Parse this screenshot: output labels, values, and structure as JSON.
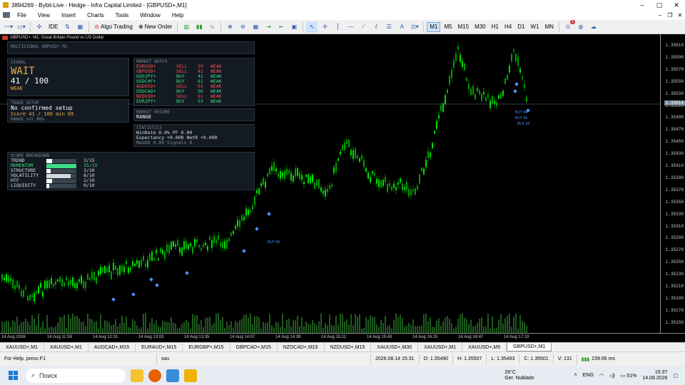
{
  "window": {
    "title": "3894269 - Bybit-Live - Hedge - Infra Capital Limited - [GBPUSD+,M1]",
    "controls": [
      "–",
      "▢",
      "✕"
    ]
  },
  "menu": {
    "items": [
      "File",
      "View",
      "Insert",
      "Charts",
      "Tools",
      "Window",
      "Help"
    ],
    "mdi_controls": [
      "–",
      "❐",
      "✕"
    ]
  },
  "toolbar": {
    "ide_label": "IDE",
    "algo_label": "Algo Trading",
    "new_order_label": "New Order",
    "timeframes": [
      "M1",
      "M5",
      "M15",
      "M30",
      "H1",
      "H4",
      "D1",
      "W1",
      "MN"
    ],
    "active_timeframe": "M1",
    "notification_count": "1"
  },
  "chart": {
    "header": "GBPUSD+, M1:  Great Britain Pound vs US Dollar",
    "subheader": "MULTISIGNAL   GBPUSD+ M1",
    "current_price": "1.35514",
    "price_labels": [
      "1.35610",
      "1.35590",
      "1.35570",
      "1.35550",
      "1.35530",
      "1.35510",
      "1.35490",
      "1.35470",
      "1.35450",
      "1.35430",
      "1.35410",
      "1.35390",
      "1.35370",
      "1.35350",
      "1.35330",
      "1.35310",
      "1.35290",
      "1.35270",
      "1.35250",
      "1.35230",
      "1.35210",
      "1.35190",
      "1.35170",
      "1.35150"
    ],
    "time_labels": [
      "14 Aug 2026",
      "14 Aug 11:59",
      "14 Aug 12:31",
      "14 Aug 13:03",
      "14 Aug 13:35",
      "14 Aug 14:07",
      "14 Aug 14:39",
      "14 Aug 15:11",
      "14 Aug 15:43",
      "14 Aug 16:15",
      "14 Aug 16:47",
      "14 Aug 17:19"
    ],
    "buy_labels": [
      "BUY 84",
      "BUY 65",
      "BUY 84",
      "BUY 65"
    ],
    "colors": {
      "bull": "#00e000",
      "bear": "#00a000",
      "bg": "#000000",
      "signal": "#4a90ff"
    }
  },
  "signal_panel": {
    "heading": "SIGNAL",
    "state": "WAIT",
    "score": "41 / 100",
    "strength": "WEAK"
  },
  "trade_setup": {
    "heading": "TRADE SETUP",
    "line1": "No confirmed setup",
    "line2": "Score 41 / 100   min 65",
    "line3": "RANGE   vol 86%"
  },
  "score_breakdown": {
    "heading": "SCORE BREAKDOWN",
    "rows": [
      {
        "name": "TREND",
        "value": "3/15",
        "fill": 0.2,
        "color": "#ffffff"
      },
      {
        "name": "MOMENTUM",
        "value": "15/15",
        "fill": 1.0,
        "color": "#3ddc84"
      },
      {
        "name": "STRUCTURE",
        "value": "3/20",
        "fill": 0.15,
        "color": "#ffffff"
      },
      {
        "name": "VOLATILITY",
        "value": "8/10",
        "fill": 0.8,
        "color": "#cfd8dc"
      },
      {
        "name": "HTF",
        "value": "2/10",
        "fill": 0.2,
        "color": "#ffffff"
      },
      {
        "name": "LIQUIDITY",
        "value": "0/10",
        "fill": 0.0,
        "color": "#ffffff"
      }
    ]
  },
  "market_watch": {
    "heading": "MARKET WATCH",
    "rows": [
      {
        "sym": "EURUSD+",
        "dir": "SELL",
        "score": "39",
        "str": "WEAK",
        "color": "#ff5252"
      },
      {
        "sym": "GBPUSD+",
        "dir": "SELL",
        "score": "41",
        "str": "WEAK",
        "color": "#ff5252"
      },
      {
        "sym": "USDJPY+",
        "dir": "BUY",
        "score": "41",
        "str": "WEAK",
        "color": "#3ddc84"
      },
      {
        "sym": "USDCHF+",
        "dir": "BUY",
        "score": "61",
        "str": "WEAK",
        "color": "#3ddc84"
      },
      {
        "sym": "AUDUSD+",
        "dir": "SELL",
        "score": "51",
        "str": "WEAK",
        "color": "#ff5252"
      },
      {
        "sym": "USDCAD+",
        "dir": "BUY",
        "score": "56",
        "str": "WEAK",
        "color": "#3ddc84"
      },
      {
        "sym": "NZDUSD+",
        "dir": "SELL",
        "score": "61",
        "str": "WEAK",
        "color": "#ff5252"
      },
      {
        "sym": "EURJPY+",
        "dir": "BUY",
        "score": "53",
        "str": "WEAK",
        "color": "#3ddc84"
      }
    ]
  },
  "market_regime": {
    "heading": "MARKET REGIME",
    "value": "RANGE"
  },
  "statistics": {
    "heading": "STATISTICS",
    "line1": "WinRate 0.0%   PF 0.00",
    "line2": "Expectancy +0.00R   NetR +0.00R",
    "line3": "MaxDD 0.00   Signals 0"
  },
  "tabs": [
    "XAUUSD+,M1",
    "XAUUSD+,M1",
    "AUDCAD+,M15",
    "EURAUD+,M15",
    "EURGBP+,M15",
    "GBPCAD+,M15",
    "NZDCAD+,M15",
    "NZDUSD+,M15",
    "XAUUSD+,M30",
    "XAUUSD+,M1",
    "XAUUSD+,M5",
    "GBPUSD+,M1"
  ],
  "active_tab_index": 11,
  "status": {
    "help": "For Help, press F1",
    "profile": "xau",
    "datetime": "2026.08.14 15:31",
    "open": "O: 1.35490",
    "high": "H: 1.35507",
    "low": "L: 1.35483",
    "close": "C: 1.35501",
    "volume": "V: 131",
    "ping": "239.66 ms"
  },
  "taskbar": {
    "search_placeholder": "Поиск",
    "weather_temp": "26°C",
    "weather_desc": "Ger. Nublado",
    "lang": "ENG",
    "battery": "51%",
    "time": "15:37",
    "date": "14.08.2026"
  }
}
